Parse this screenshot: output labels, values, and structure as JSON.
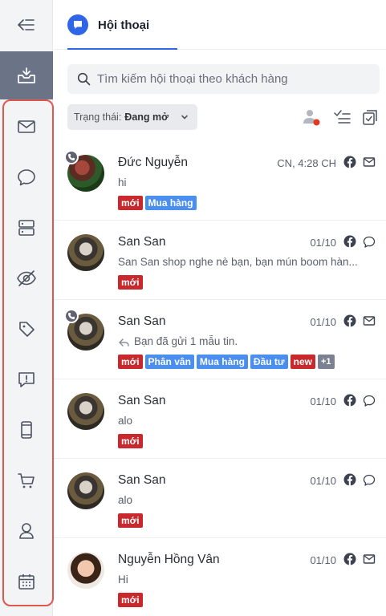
{
  "colors": {
    "accent": "#2f66e8",
    "rail_active": "#6b7487",
    "tag_red": "#c9282d",
    "tag_blue": "#4a8ef0",
    "highlight_border": "#e0574b"
  },
  "sidebar": {
    "items": [
      {
        "icon": "collapse-icon"
      },
      {
        "icon": "inbox-icon",
        "active": true
      },
      {
        "icon": "mail-icon"
      },
      {
        "icon": "chat-bubble-icon"
      },
      {
        "icon": "server-icon"
      },
      {
        "icon": "eye-off-icon"
      },
      {
        "icon": "tag-icon"
      },
      {
        "icon": "report-icon"
      },
      {
        "icon": "mobile-icon"
      },
      {
        "icon": "cart-icon"
      },
      {
        "icon": "user-icon"
      },
      {
        "icon": "calendar-icon"
      }
    ]
  },
  "header": {
    "tab_label": "Hội thoại"
  },
  "search": {
    "placeholder": "Tìm kiếm hội thoại theo khách hàng"
  },
  "filter": {
    "label": "Trạng thái:",
    "value": "Đang mở"
  },
  "conversations": [
    {
      "name": "Đức Nguyễn",
      "time": "CN, 4:28 CH",
      "preview": "hi",
      "channel": "mail-icon",
      "call": true,
      "sent": false,
      "tags": [
        {
          "text": "mới",
          "color": "red"
        },
        {
          "text": "Mua hàng",
          "color": "blue"
        }
      ]
    },
    {
      "name": "San San",
      "time": "01/10",
      "preview": "San San shop nghe nè bạn, bạn mún boom hàn...",
      "channel": "chat-bubble-icon",
      "call": false,
      "sent": false,
      "tags": [
        {
          "text": "mới",
          "color": "red"
        }
      ]
    },
    {
      "name": "San San",
      "time": "01/10",
      "preview": "Bạn đã gửi 1 mẫu tin.",
      "channel": "mail-icon",
      "call": true,
      "sent": true,
      "tags": [
        {
          "text": "mới",
          "color": "red"
        },
        {
          "text": "Phân vân",
          "color": "blue"
        },
        {
          "text": "Mua hàng",
          "color": "blue"
        },
        {
          "text": "Đầu tư",
          "color": "blue"
        },
        {
          "text": "new",
          "color": "red"
        },
        {
          "text": "+1",
          "color": "gray"
        }
      ]
    },
    {
      "name": "San San",
      "time": "01/10",
      "preview": "alo",
      "channel": "chat-bubble-icon",
      "call": false,
      "sent": false,
      "tags": [
        {
          "text": "mới",
          "color": "red"
        }
      ]
    },
    {
      "name": "San San",
      "time": "01/10",
      "preview": "alo",
      "channel": "chat-bubble-icon",
      "call": false,
      "sent": false,
      "tags": [
        {
          "text": "mới",
          "color": "red"
        }
      ]
    },
    {
      "name": "Nguyễn Hồng Vân",
      "time": "01/10",
      "preview": "Hi",
      "channel": "mail-icon",
      "call": false,
      "sent": false,
      "tags": [
        {
          "text": "mới",
          "color": "red"
        }
      ]
    }
  ]
}
